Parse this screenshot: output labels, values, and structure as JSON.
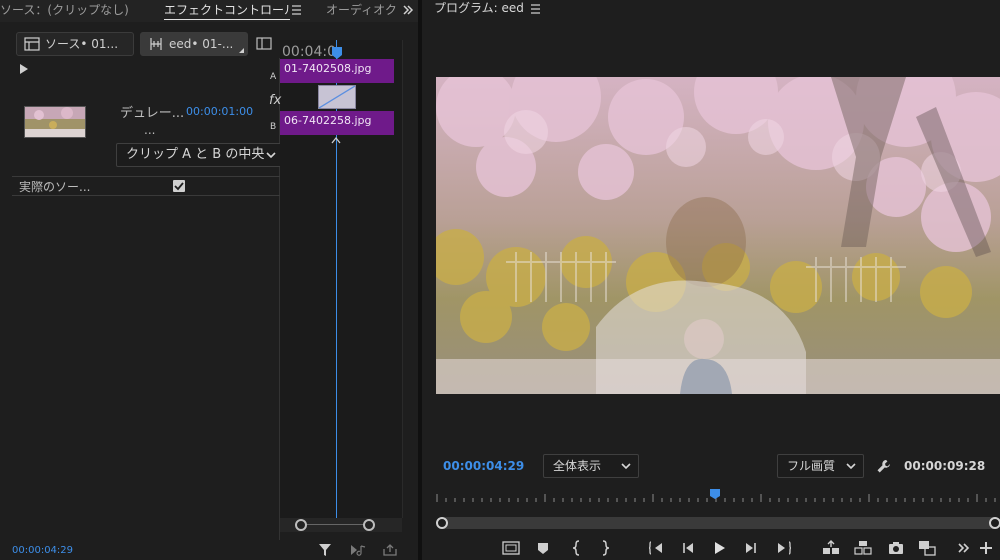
{
  "left_panel": {
    "tabs": {
      "source": "ソース：(クリップなし)",
      "effect_controls": "エフェクトコントロール",
      "audio": "オーディオク"
    },
    "clip_tabs": {
      "source_label": "ソース• 01...",
      "sequence_label": "eed• 01-..."
    },
    "controls": {
      "duration_label": "デュレー...",
      "duration_value": "00:00:01:00",
      "more": "...",
      "alignment_value": "クリップ A と B の中央",
      "actual_source_label": "実際のソー..."
    },
    "timeline": {
      "timecode": "00:04:0",
      "track_a_label": "A",
      "track_b_label": "B",
      "clip_a_name": "01-7402508.jpg",
      "clip_b_name": "06-7402258.jpg",
      "fx_label": "fx"
    },
    "footer": {
      "timecode": "00:00:04:29"
    }
  },
  "program": {
    "title": "プログラム: eed",
    "current_time": "00:00:04:29",
    "zoom_value": "全体表示",
    "quality_value": "フル画質",
    "duration": "00:00:09:28"
  },
  "colors": {
    "accent_blue": "#3d8ee8",
    "clip_purple": "#6f1a8a",
    "panel_bg": "#1e1e1e"
  }
}
